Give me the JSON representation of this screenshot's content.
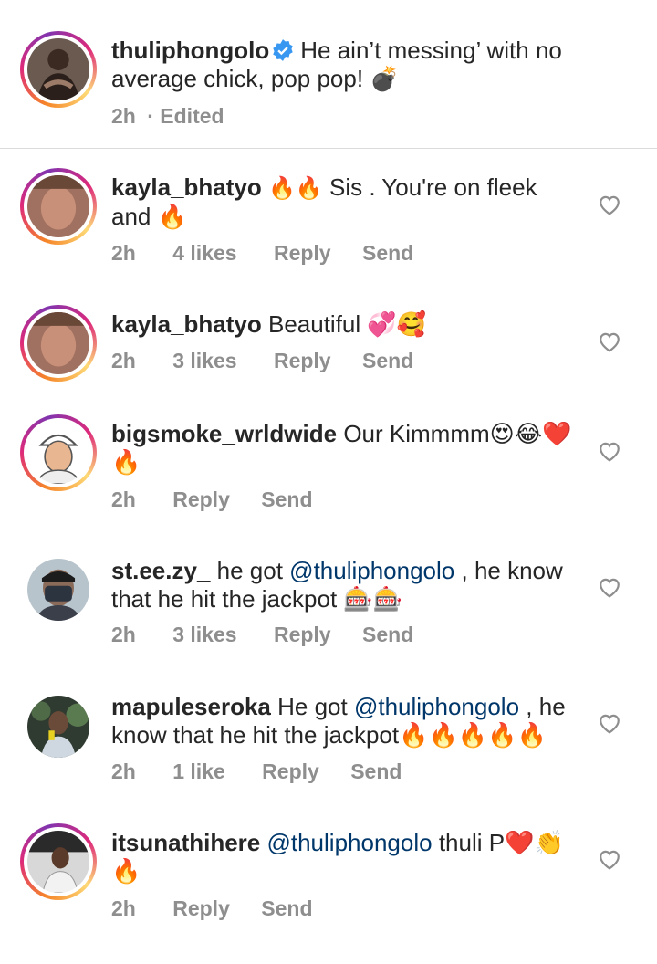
{
  "caption": {
    "username": "thuliphongolo",
    "text": "He ain’t messing’ with no average chick, pop pop! 💣",
    "time": "2h",
    "edited": "· Edited"
  },
  "comments": [
    {
      "username": "kayla_bhatyo",
      "prefix": "🔥🔥",
      "text": "Sis . You're on fleek and 🔥",
      "time": "2h",
      "likes": "4 likes",
      "reply": "Reply",
      "send": "Send"
    },
    {
      "username": "kayla_bhatyo",
      "text": "Beautiful 💞🥰",
      "time": "2h",
      "likes": "3 likes",
      "reply": "Reply",
      "send": "Send"
    },
    {
      "username": "bigsmoke_wrldwide",
      "text": "Our Kimmmm😍😂❤️🔥",
      "time": "2h",
      "reply": "Reply",
      "send": "Send"
    },
    {
      "username": "st.ee.zy_",
      "text_before": "he got",
      "mention": "@thuliphongolo",
      "text_after": ", he know that he hit the jackpot 🎰🎰",
      "time": "2h",
      "likes": "3 likes",
      "reply": "Reply",
      "send": "Send"
    },
    {
      "username": "mapuleseroka",
      "text_before": "He got",
      "mention": "@thuliphongolo",
      "text_after": ", he know that he hit the jackpot🔥🔥🔥🔥🔥",
      "time": "2h",
      "likes": "1 like",
      "reply": "Reply",
      "send": "Send"
    },
    {
      "username": "itsunathihere",
      "mention": "@thuliphongolo",
      "text_after": "thuli P❤️👏🔥",
      "time": "2h",
      "reply": "Reply",
      "send": "Send"
    }
  ],
  "colors": {
    "mention": "#00376b",
    "meta": "#8e8e8e",
    "text": "#262626",
    "verified": "#3897f0"
  }
}
